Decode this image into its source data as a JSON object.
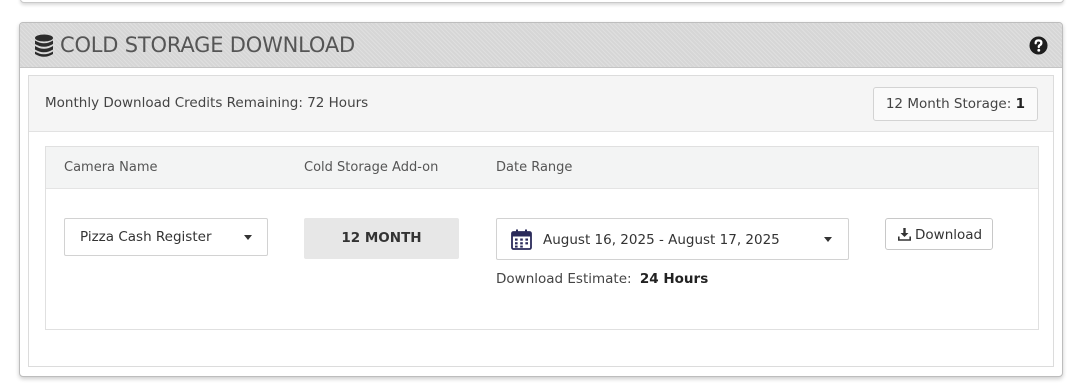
{
  "panel": {
    "title": "COLD STORAGE DOWNLOAD",
    "icons": {
      "title": "database-icon",
      "help": "question-circle-icon"
    }
  },
  "summary": {
    "credits_text": "Monthly Download Credits Remaining: 72 Hours",
    "storage_label": "12 Month Storage:",
    "storage_count": "1"
  },
  "table": {
    "columns": [
      "Camera Name",
      "Cold Storage Add-on",
      "Date Range"
    ],
    "row": {
      "camera": "Pizza Cash Register",
      "addon": "12 MONTH",
      "date_range": "August 16, 2025 - August 17, 2025",
      "estimate_label": "Download Estimate:",
      "estimate_value": "24 Hours",
      "download_label": "Download"
    }
  },
  "icons": {
    "camera_caret": "caret-down-icon",
    "calendar": "calendar-icon",
    "date_caret": "caret-down-icon",
    "download": "download-icon"
  },
  "colors": {
    "header_bg": "#d6d6d6",
    "addon_bg": "#e7e7e7",
    "text": "#333333"
  }
}
